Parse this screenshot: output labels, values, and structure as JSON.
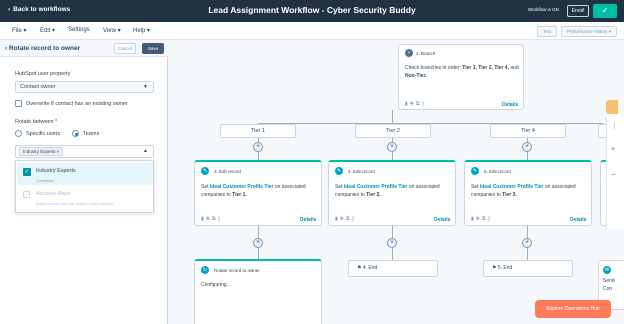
{
  "header": {
    "back_label": "Back to workflows",
    "title": "Lead Assignment Workflow - Cyber Security Buddy",
    "status": "Workflow is ON",
    "enroll_label": "Enroll"
  },
  "menu": {
    "file": "File",
    "edit": "Edit",
    "settings": "Settings",
    "view": "View",
    "help": "Help",
    "test": "Test",
    "history": "Performance history"
  },
  "panel": {
    "title": "Rotate record to owner",
    "cancel": "Cancel",
    "save": "Save",
    "property_label": "HubSpot user property",
    "property_value": "Contact owner",
    "overwrite_label": "Overwrite if contact has an existing owner",
    "rotate_label": "Rotate between *",
    "specific_users": "Specific users",
    "teams": "Teams",
    "chip": "Industry Experts",
    "option1": "Industry Experts",
    "option1_sub": "1 member",
    "option2": "Account Reps",
    "option2_sub": "Empty teams can't be used for lead rotation."
  },
  "canvas": {
    "branch_title": "2. Branch",
    "branch_text_pre": "Check branches in order: ",
    "branch_tiers": "Tier 1, Tier 2, Tier 4,",
    "branch_and": "and ",
    "branch_last": "Non-Tier.",
    "details": "Details",
    "tier1": "Tier 1",
    "tier2": "Tier 2",
    "tier4": "Tier 4",
    "edit3_title": "3. Edit record",
    "edit4_title": "4. Edit record",
    "edit5_title": "5. Edit record",
    "set": "Set ",
    "prop": "Ideal Customer Profile Tier",
    "on_assoc": " on associated companies to ",
    "t1": "Tier 1.",
    "t2": "Tier 2.",
    "t3": "Tier 3.",
    "rotate_title": "Rotate record to owner",
    "configuring": "Configuring...",
    "end4": "4. End",
    "end5": "5. End",
    "explore": "Explore Operations Hub",
    "partial1": "Send",
    "partial2": "Con"
  }
}
